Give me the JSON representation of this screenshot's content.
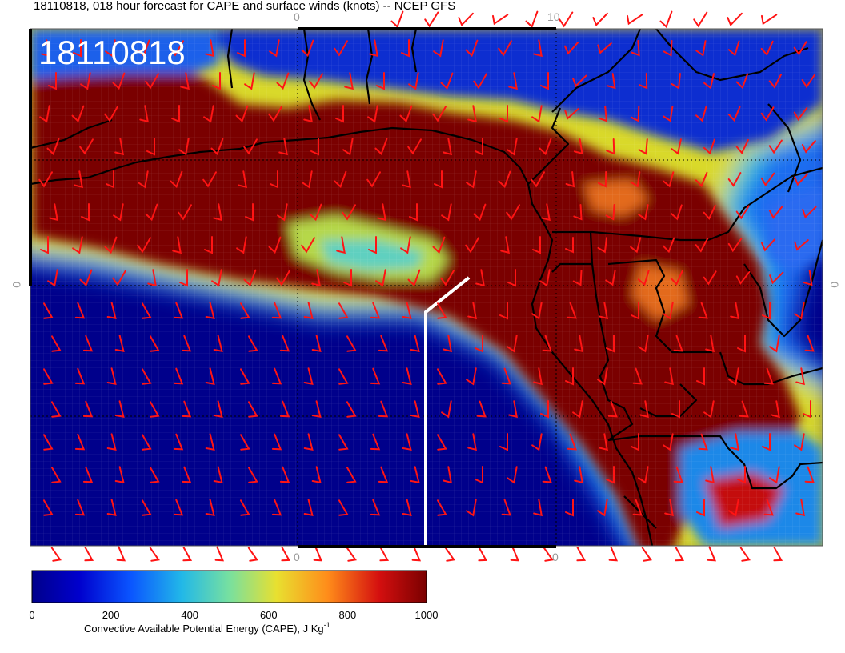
{
  "header": {
    "title": "18110818, 018 hour forecast for CAPE and surface winds (knots) -- NCEP GFS",
    "stamp": "18110818"
  },
  "map": {
    "axis_labels": {
      "top_left": "0",
      "top_right": "10",
      "bottom_left": "0",
      "bottom_right": "0",
      "left_mid": "0",
      "right_mid": "0"
    },
    "colors": {
      "ocean_low": "#00008b",
      "high_cape": "#7a0000",
      "transition_cyan": "#27c4d8",
      "transition_yellow": "#d9d92a",
      "wind_barb": "#ff1414",
      "coastline": "#000000",
      "track_line": "#ffffff"
    }
  },
  "colorbar": {
    "ticks": [
      "0",
      "200",
      "400",
      "600",
      "800",
      "1000"
    ],
    "label": "Convective Available Potential Energy (CAPE), J Kg",
    "label_sup": "-1",
    "min": 0,
    "max": 1000
  }
}
